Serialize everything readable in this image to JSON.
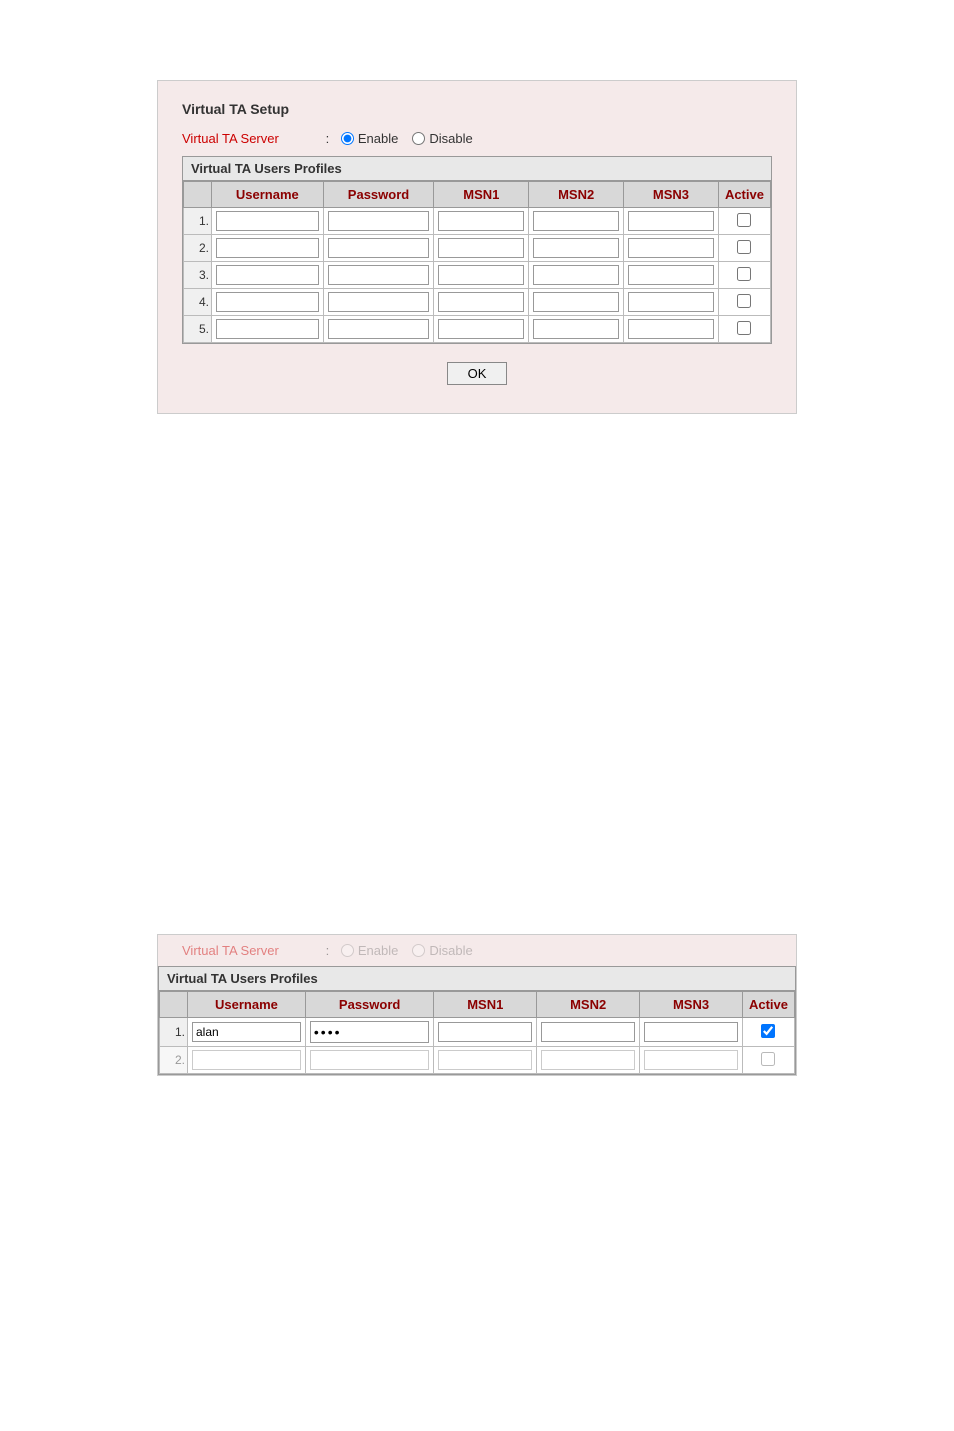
{
  "top_panel": {
    "title": "Virtual TA Setup",
    "server_label": "Virtual TA Server",
    "colon": ":",
    "enable_label": "Enable",
    "disable_label": "Disable",
    "profiles_section_title": "Virtual TA Users Profiles",
    "table_headers": {
      "username": "Username",
      "password": "Password",
      "msn1": "MSN1",
      "msn2": "MSN2",
      "msn3": "MSN3",
      "active": "Active"
    },
    "rows": [
      {
        "num": "1.",
        "username": "",
        "password": "",
        "msn1": "",
        "msn2": "",
        "msn3": "",
        "active": false
      },
      {
        "num": "2.",
        "username": "",
        "password": "",
        "msn1": "",
        "msn2": "",
        "msn3": "",
        "active": false
      },
      {
        "num": "3.",
        "username": "",
        "password": "",
        "msn1": "",
        "msn2": "",
        "msn3": "",
        "active": false
      },
      {
        "num": "4.",
        "username": "",
        "password": "",
        "msn1": "",
        "msn2": "",
        "msn3": "",
        "active": false
      },
      {
        "num": "5.",
        "username": "",
        "password": "",
        "msn1": "",
        "msn2": "",
        "msn3": "",
        "active": false
      }
    ],
    "ok_button": "OK"
  },
  "bottom_panel": {
    "server_label": "Virtual TA Server",
    "colon": ":",
    "enable_label": "Enable",
    "disable_label": "Disable",
    "profiles_section_title": "Virtual TA Users Profiles",
    "table_headers": {
      "username": "Username",
      "password": "Password",
      "msn1": "MSN1",
      "msn2": "MSN2",
      "msn3": "MSN3",
      "active": "Active"
    },
    "row1": {
      "num": "1.",
      "username": "alan",
      "password": "••••",
      "msn1": "",
      "msn2": "",
      "msn3": "",
      "active": true
    },
    "row2_partial": {
      "num": "2.",
      "username": "",
      "password": "",
      "msn1": "",
      "msn2": "",
      "msn3": "",
      "active": false
    }
  },
  "colors": {
    "header_red": "#8b0000",
    "link_red": "#c00000",
    "panel_bg": "#f5eaea",
    "table_header_bg": "#d8d8d8",
    "border": "#999999"
  }
}
